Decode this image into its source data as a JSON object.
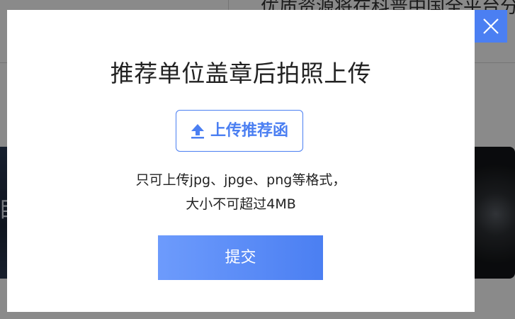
{
  "background": {
    "headline_fragment": "优质资源将在科普中国全平台分发"
  },
  "modal": {
    "title": "推荐单位盖章后拍照上传",
    "close_icon": "close-icon",
    "upload_button": {
      "icon": "upload-arrow-icon",
      "label": "上传推荐函"
    },
    "hint_line_1": "只可上传jpg、jpge、png等格式，",
    "hint_line_2": "大小不可超过4MB",
    "submit_label": "提交"
  },
  "colors": {
    "accent": "#4b7ff2",
    "accent_light": "#6d9bfc",
    "overlay": "rgba(0,0,0,0.46)",
    "title_text": "#222222"
  }
}
